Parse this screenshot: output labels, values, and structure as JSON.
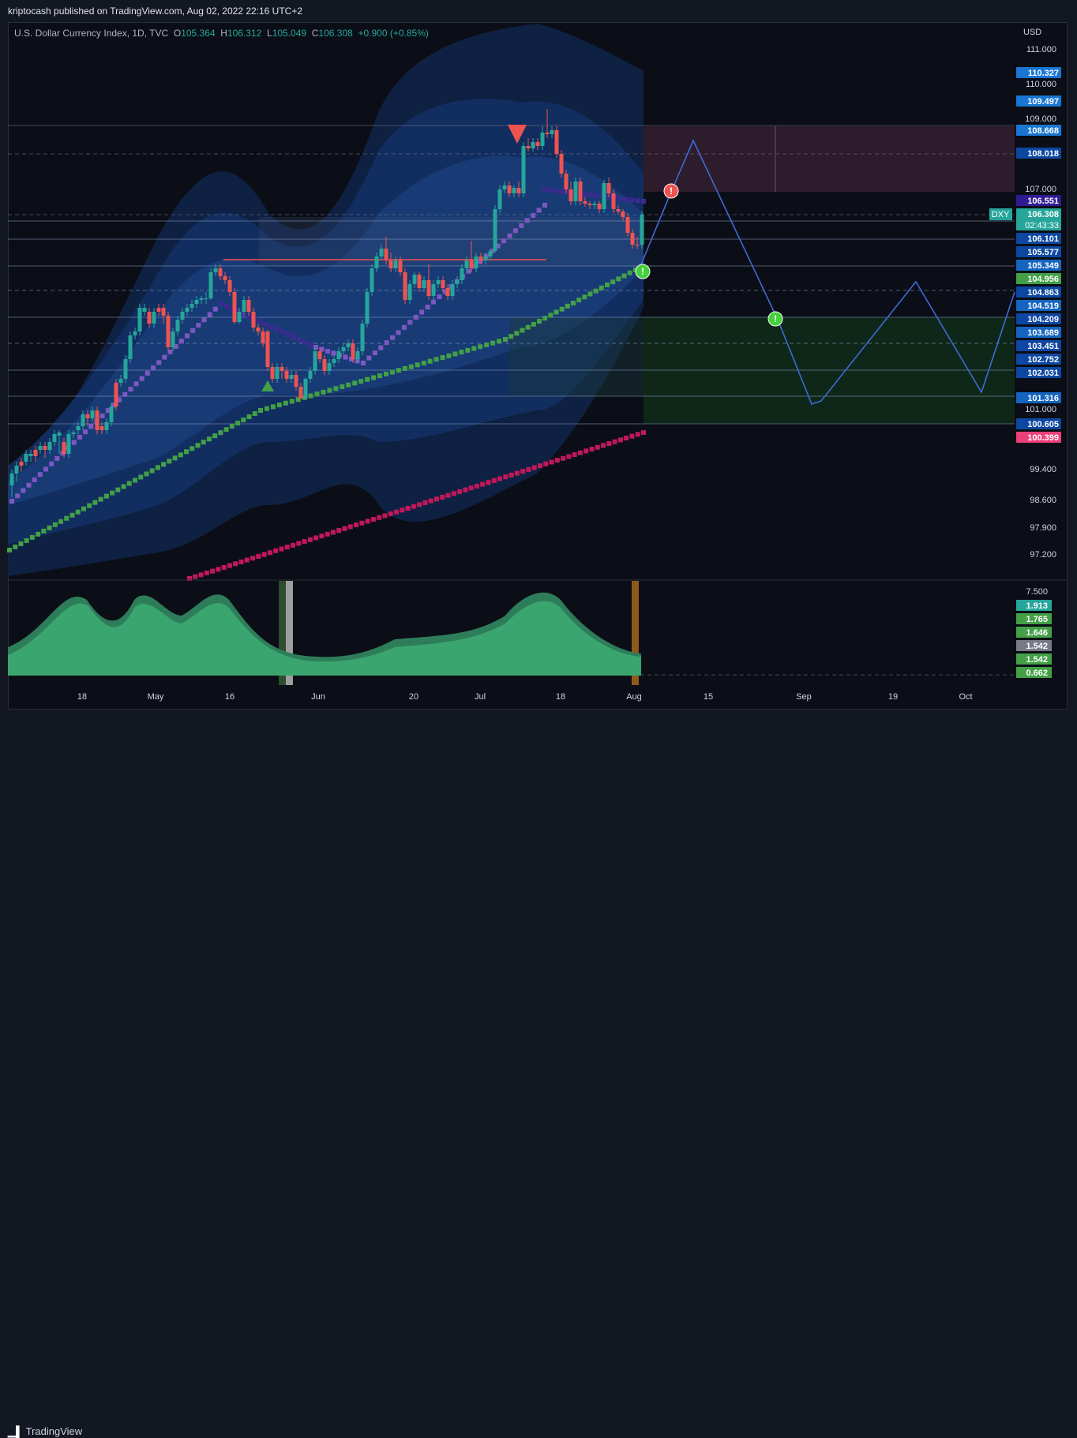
{
  "publisher": "kriptocash published on TradingView.com, Aug 02, 2022 22:16 UTC+2",
  "legend": {
    "symbol": "U.S. Dollar Currency Index, 1D, TVC",
    "o_label": "O",
    "o": "105.364",
    "h_label": "H",
    "h": "106.312",
    "l_label": "L",
    "l": "105.049",
    "c_label": "C",
    "c": "106.308",
    "change": "+0.900 (+0.85%)"
  },
  "currency": "USD",
  "footer": {
    "logo": "TradingView"
  },
  "colors": {
    "up": "#26a69a",
    "down": "#ef5350",
    "background": "#0b0e16"
  },
  "chart_data": {
    "type": "candlestick",
    "symbol_tag": "DXY",
    "countdown": "02:43:33",
    "y_ticks": [
      "111.000",
      "110.000",
      "109.000",
      "107.000",
      "101.000",
      "99.400",
      "98.600",
      "97.900",
      "97.200"
    ],
    "x_ticks": [
      "18",
      "May",
      "16",
      "Jun",
      "20",
      "Jul",
      "18",
      "Aug",
      "15",
      "Sep",
      "19",
      "Oct"
    ],
    "price_badges": [
      {
        "value": "110.327",
        "color": "#1976d2"
      },
      {
        "value": "109.497",
        "color": "#1976d2"
      },
      {
        "value": "108.668",
        "color": "#1976d2"
      },
      {
        "value": "108.018",
        "color": "#0d47a1"
      },
      {
        "value": "106.551",
        "color": "#311b92"
      },
      {
        "value": "106.308",
        "color": "#26a69a"
      },
      {
        "value": "106.101",
        "color": "#0d47a1"
      },
      {
        "value": "105.577",
        "color": "#0d47a1"
      },
      {
        "value": "105.349",
        "color": "#1565c0"
      },
      {
        "value": "104.956",
        "color": "#43a047"
      },
      {
        "value": "104.863",
        "color": "#0d47a1"
      },
      {
        "value": "104.519",
        "color": "#1565c0"
      },
      {
        "value": "104.209",
        "color": "#0d47a1"
      },
      {
        "value": "103.689",
        "color": "#1565c0"
      },
      {
        "value": "103.451",
        "color": "#0d47a1"
      },
      {
        "value": "102.752",
        "color": "#0d47a1"
      },
      {
        "value": "102.031",
        "color": "#0d47a1"
      },
      {
        "value": "101.316",
        "color": "#1565c0"
      },
      {
        "value": "100.605",
        "color": "#0d47a1"
      },
      {
        "value": "100.399",
        "color": "#ec407a"
      }
    ],
    "oscillator": {
      "ticks": [
        "7.500"
      ],
      "badges": [
        {
          "value": "1.913",
          "color": "#26a69a"
        },
        {
          "value": "1.765",
          "color": "#43a047"
        },
        {
          "value": "1.646",
          "color": "#43a047"
        },
        {
          "value": "1.542",
          "color": "#787b86"
        },
        {
          "value": "1.542",
          "color": "#43a047"
        },
        {
          "value": "0.662",
          "color": "#43a047"
        }
      ]
    }
  }
}
